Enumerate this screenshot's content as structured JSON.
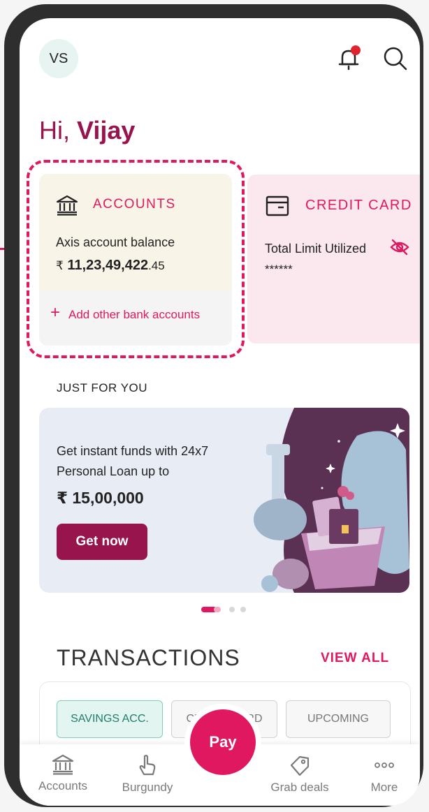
{
  "header": {
    "avatar_initials": "VS",
    "greeting_prefix": "Hi,",
    "greeting_name": "Vijay",
    "bell_icon": "bell-icon",
    "search_icon": "search-icon"
  },
  "accounts_card": {
    "title": "ACCOUNTS",
    "icon": "bank-icon",
    "balance_label": "Axis account balance",
    "currency": "₹",
    "balance_main": "11,23,49,422",
    "balance_decimal": ".45",
    "add_label": "Add other bank accounts"
  },
  "credit_card": {
    "title": "CREDIT CARD",
    "icon": "card-icon",
    "limit_label": "Total Limit Utilized",
    "masked_value": "******"
  },
  "just_for_you": {
    "section_title": "JUST FOR YOU",
    "banner_line1": "Get instant funds with 24x7",
    "banner_line2": "Personal Loan up to",
    "banner_amount": "₹ 15,00,000",
    "cta": "Get now"
  },
  "transactions": {
    "title": "TRANSACTIONS",
    "view_all": "VIEW ALL",
    "tabs": [
      "SAVINGS ACC.",
      "CREDIT CARD",
      "UPCOMING"
    ]
  },
  "bottom_nav": {
    "items": [
      "Accounts",
      "Burgundy",
      "Grab deals",
      "More"
    ],
    "pay": "Pay"
  },
  "colors": {
    "brand": "#97144d",
    "accent": "#e0185f",
    "accounts_bg": "#f8f5e8",
    "credit_bg": "#fbe8ee",
    "banner_bg": "#e8ecf5"
  }
}
